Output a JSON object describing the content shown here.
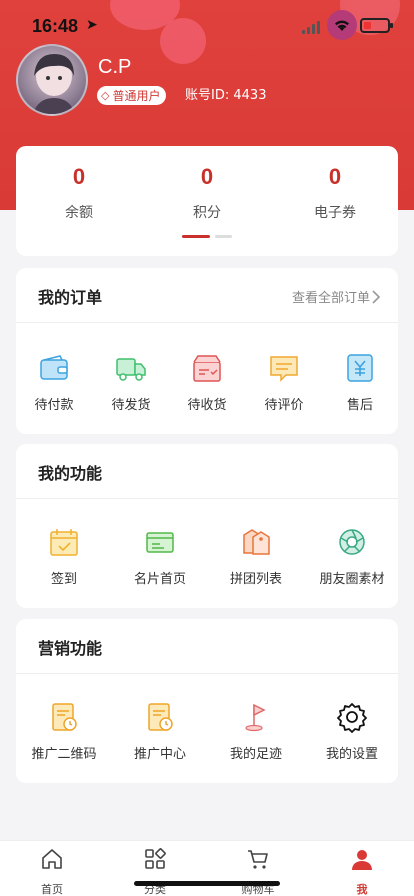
{
  "status": {
    "time": "16:48"
  },
  "profile": {
    "name": "C.P",
    "badge": "普通用户",
    "account_label": "账号ID:",
    "account_id": "4433"
  },
  "stats": [
    {
      "value": "0",
      "label": "余额"
    },
    {
      "value": "0",
      "label": "积分"
    },
    {
      "value": "0",
      "label": "电子券"
    }
  ],
  "orders": {
    "title": "我的订单",
    "view_all": "查看全部订单",
    "items": [
      {
        "label": "待付款",
        "icon": "wallet-icon"
      },
      {
        "label": "待发货",
        "icon": "truck-icon"
      },
      {
        "label": "待收货",
        "icon": "box-icon"
      },
      {
        "label": "待评价",
        "icon": "comment-icon"
      },
      {
        "label": "售后",
        "icon": "yen-refund-icon"
      }
    ]
  },
  "functions": {
    "title": "我的功能",
    "items": [
      {
        "label": "签到",
        "icon": "calendar-check-icon"
      },
      {
        "label": "名片首页",
        "icon": "card-icon"
      },
      {
        "label": "拼团列表",
        "icon": "tag-icon"
      },
      {
        "label": "朋友圈素材",
        "icon": "aperture-icon"
      }
    ]
  },
  "marketing": {
    "title": "营销功能",
    "items": [
      {
        "label": "推广二维码",
        "icon": "promo-doc-icon"
      },
      {
        "label": "推广中心",
        "icon": "promo-center-icon"
      },
      {
        "label": "我的足迹",
        "icon": "flag-icon"
      },
      {
        "label": "我的设置",
        "icon": "gear-icon"
      }
    ]
  },
  "tabbar": [
    {
      "label": "首页",
      "icon": "home-icon",
      "active": false
    },
    {
      "label": "分类",
      "icon": "grid-icon",
      "active": false
    },
    {
      "label": "购物车",
      "icon": "cart-icon",
      "active": false
    },
    {
      "label": "我",
      "icon": "user-icon",
      "active": true
    }
  ],
  "colors": {
    "brand": "#d93a36",
    "accent_text": "#c9302c"
  }
}
